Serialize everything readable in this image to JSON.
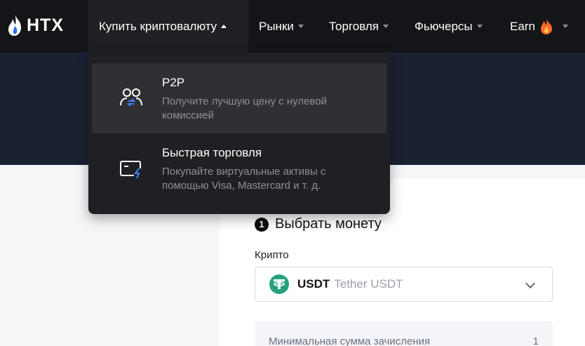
{
  "nav": {
    "logo_text": "HTX",
    "items": [
      {
        "label": "Купить криптовалюту"
      },
      {
        "label": "Рынки"
      },
      {
        "label": "Торговля"
      },
      {
        "label": "Фьючерсы"
      },
      {
        "label": "Earn"
      }
    ]
  },
  "dropdown": {
    "items": [
      {
        "title": "P2P",
        "description": "Получите лучшую цену с нулевой комиссией",
        "icon": "users-swap-icon"
      },
      {
        "title": "Быстрая торговля",
        "description": "Покупайте виртуальные активы с помощью Visa, Mastercard и т. д.",
        "icon": "card-lightning-icon"
      }
    ]
  },
  "form": {
    "step_number": "1",
    "step_title": "Выбрать монету",
    "crypto_label": "Крипто",
    "selected_symbol": "USDT",
    "selected_name": "Tether USDT",
    "min_label": "Минимальная сумма зачисления",
    "min_value": "1"
  },
  "colors": {
    "nav_bg": "#141519",
    "dropdown_bg": "#1f2024",
    "hover_bg": "#2f3034",
    "accent_blue": "#3b82f6",
    "usdt_green": "#26a17b"
  }
}
